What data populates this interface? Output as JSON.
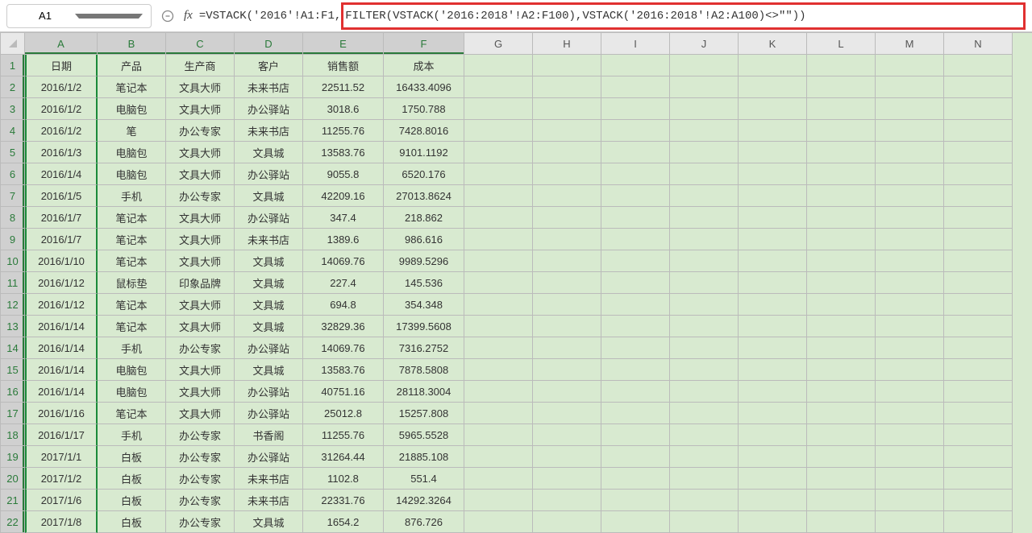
{
  "nameBox": "A1",
  "fxLabel": "fx",
  "formulaPrefix": "=VSTACK('2016'!A1:F1,",
  "formulaHighlight": "FILTER(VSTACK('2016:2018'!A2:F100),VSTACK('2016:2018'!A2:A100)<>\"\"))",
  "columns": [
    "A",
    "B",
    "C",
    "D",
    "E",
    "F",
    "G",
    "H",
    "I",
    "J",
    "K",
    "L",
    "M",
    "N"
  ],
  "selectedColumns": [
    "A",
    "B",
    "C",
    "D",
    "E",
    "F"
  ],
  "headers": [
    "日期",
    "产品",
    "生产商",
    "客户",
    "销售额",
    "成本"
  ],
  "rows": [
    {
      "n": 1,
      "d": [
        "日期",
        "产品",
        "生产商",
        "客户",
        "销售额",
        "成本"
      ]
    },
    {
      "n": 2,
      "d": [
        "2016/1/2",
        "笔记本",
        "文具大师",
        "未来书店",
        "22511.52",
        "16433.4096"
      ]
    },
    {
      "n": 3,
      "d": [
        "2016/1/2",
        "电脑包",
        "文具大师",
        "办公驿站",
        "3018.6",
        "1750.788"
      ]
    },
    {
      "n": 4,
      "d": [
        "2016/1/2",
        "笔",
        "办公专家",
        "未来书店",
        "11255.76",
        "7428.8016"
      ]
    },
    {
      "n": 5,
      "d": [
        "2016/1/3",
        "电脑包",
        "文具大师",
        "文具城",
        "13583.76",
        "9101.1192"
      ]
    },
    {
      "n": 6,
      "d": [
        "2016/1/4",
        "电脑包",
        "文具大师",
        "办公驿站",
        "9055.8",
        "6520.176"
      ]
    },
    {
      "n": 7,
      "d": [
        "2016/1/5",
        "手机",
        "办公专家",
        "文具城",
        "42209.16",
        "27013.8624"
      ]
    },
    {
      "n": 8,
      "d": [
        "2016/1/7",
        "笔记本",
        "文具大师",
        "办公驿站",
        "347.4",
        "218.862"
      ]
    },
    {
      "n": 9,
      "d": [
        "2016/1/7",
        "笔记本",
        "文具大师",
        "未来书店",
        "1389.6",
        "986.616"
      ]
    },
    {
      "n": 10,
      "d": [
        "2016/1/10",
        "笔记本",
        "文具大师",
        "文具城",
        "14069.76",
        "9989.5296"
      ]
    },
    {
      "n": 11,
      "d": [
        "2016/1/12",
        "鼠标垫",
        "印象品牌",
        "文具城",
        "227.4",
        "145.536"
      ]
    },
    {
      "n": 12,
      "d": [
        "2016/1/12",
        "笔记本",
        "文具大师",
        "文具城",
        "694.8",
        "354.348"
      ]
    },
    {
      "n": 13,
      "d": [
        "2016/1/14",
        "笔记本",
        "文具大师",
        "文具城",
        "32829.36",
        "17399.5608"
      ]
    },
    {
      "n": 14,
      "d": [
        "2016/1/14",
        "手机",
        "办公专家",
        "办公驿站",
        "14069.76",
        "7316.2752"
      ]
    },
    {
      "n": 15,
      "d": [
        "2016/1/14",
        "电脑包",
        "文具大师",
        "文具城",
        "13583.76",
        "7878.5808"
      ]
    },
    {
      "n": 16,
      "d": [
        "2016/1/14",
        "电脑包",
        "文具大师",
        "办公驿站",
        "40751.16",
        "28118.3004"
      ]
    },
    {
      "n": 17,
      "d": [
        "2016/1/16",
        "笔记本",
        "文具大师",
        "办公驿站",
        "25012.8",
        "15257.808"
      ]
    },
    {
      "n": 18,
      "d": [
        "2016/1/17",
        "手机",
        "办公专家",
        "书香阁",
        "11255.76",
        "5965.5528"
      ]
    },
    {
      "n": 19,
      "d": [
        "2017/1/1",
        "白板",
        "办公专家",
        "办公驿站",
        "31264.44",
        "21885.108"
      ]
    },
    {
      "n": 20,
      "d": [
        "2017/1/2",
        "白板",
        "办公专家",
        "未来书店",
        "1102.8",
        "551.4"
      ]
    },
    {
      "n": 21,
      "d": [
        "2017/1/6",
        "白板",
        "办公专家",
        "未来书店",
        "22331.76",
        "14292.3264"
      ]
    },
    {
      "n": 22,
      "d": [
        "2017/1/8",
        "白板",
        "办公专家",
        "文具城",
        "1654.2",
        "876.726"
      ]
    }
  ]
}
